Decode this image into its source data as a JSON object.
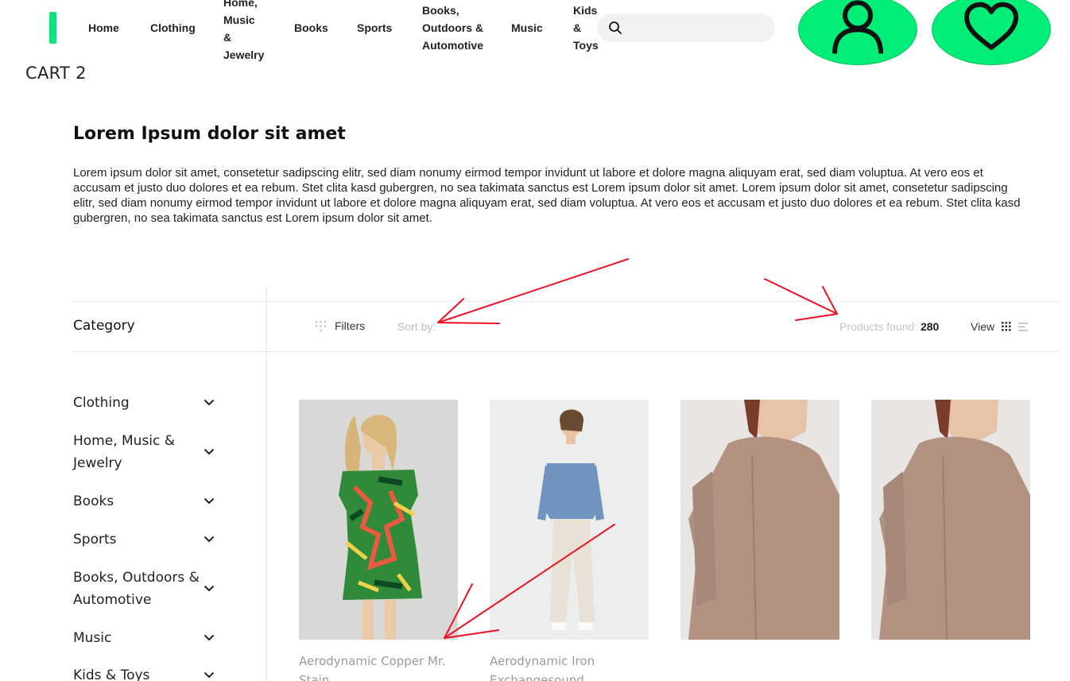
{
  "nav": {
    "items": [
      "Home",
      "Clothing",
      "Home,\nMusic\n&\nJewelry",
      "Books",
      "Sports",
      "Books,\nOutdoors &\nAutomotive",
      "Music",
      "Kids\n&\nToys"
    ]
  },
  "search": {
    "placeholder": ""
  },
  "cart_label": "CART 2",
  "page": {
    "title": "Lorem Ipsum dolor sit amet",
    "description": "Lorem ipsum dolor sit amet, consetetur sadipscing elitr, sed diam nonumy eirmod tempor invidunt ut labore et dolore magna aliquyam erat, sed diam voluptua. At vero eos et accusam et justo duo dolores et ea rebum. Stet clita kasd gubergren, no sea takimata sanctus est Lorem ipsum dolor sit amet. Lorem ipsum dolor sit amet, consetetur sadipscing elitr, sed diam nonumy eirmod tempor invidunt ut labore et dolore magna aliquyam erat, sed diam voluptua. At vero eos et accusam et justo duo dolores et ea rebum. Stet clita kasd gubergren, no sea takimata sanctus est Lorem ipsum dolor sit amet."
  },
  "toolbar": {
    "category_title": "Category",
    "filters_label": "Filters",
    "sort_label": "Sort by:",
    "found_label": "Products found:",
    "found_count": "280",
    "view_label": "View"
  },
  "categories": [
    "Clothing",
    "Home, Music & Jewelry",
    "Books",
    "Sports",
    "Books, Outdoors & Automotive",
    "Music",
    "Kids & Toys"
  ],
  "products": [
    {
      "name": "Aerodynamic Copper Mr. Stain"
    },
    {
      "name": "Aerodynamic Iron Exchangesound"
    },
    {
      "name": ""
    },
    {
      "name": ""
    }
  ],
  "colors": {
    "accent": "#00ee77",
    "annotation": "#ee1122"
  },
  "icons": {
    "search": "search-icon",
    "user": "user-icon",
    "heart": "heart-icon",
    "filters": "filter-icon",
    "grid": "grid-view-icon",
    "list": "list-view-icon",
    "chevron": "chevron-down-icon"
  }
}
